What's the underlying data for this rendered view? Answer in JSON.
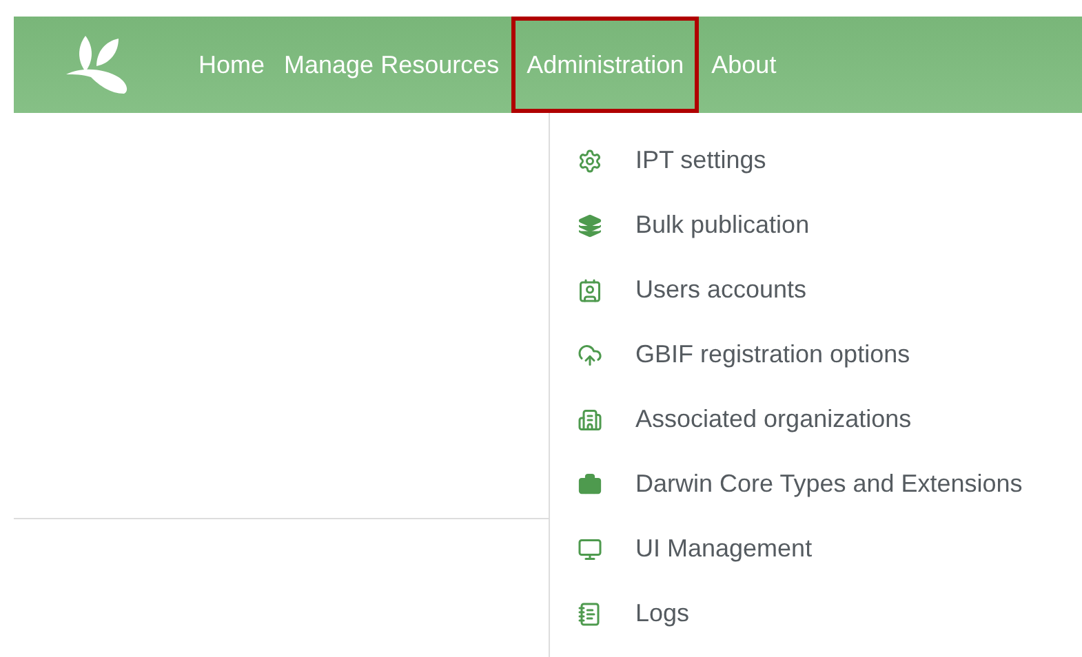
{
  "nav": {
    "items": [
      {
        "label": "Home",
        "selected": false
      },
      {
        "label": "Manage Resources",
        "selected": false
      },
      {
        "label": "Administration",
        "selected": true
      },
      {
        "label": "About",
        "selected": false
      }
    ]
  },
  "menu": {
    "items": [
      {
        "label": "IPT settings"
      },
      {
        "label": "Bulk publication"
      },
      {
        "label": "Users accounts"
      },
      {
        "label": "GBIF registration options"
      },
      {
        "label": "Associated organizations"
      },
      {
        "label": "Darwin Core Types and Extensions"
      },
      {
        "label": "UI Management"
      },
      {
        "label": "Logs"
      }
    ]
  }
}
